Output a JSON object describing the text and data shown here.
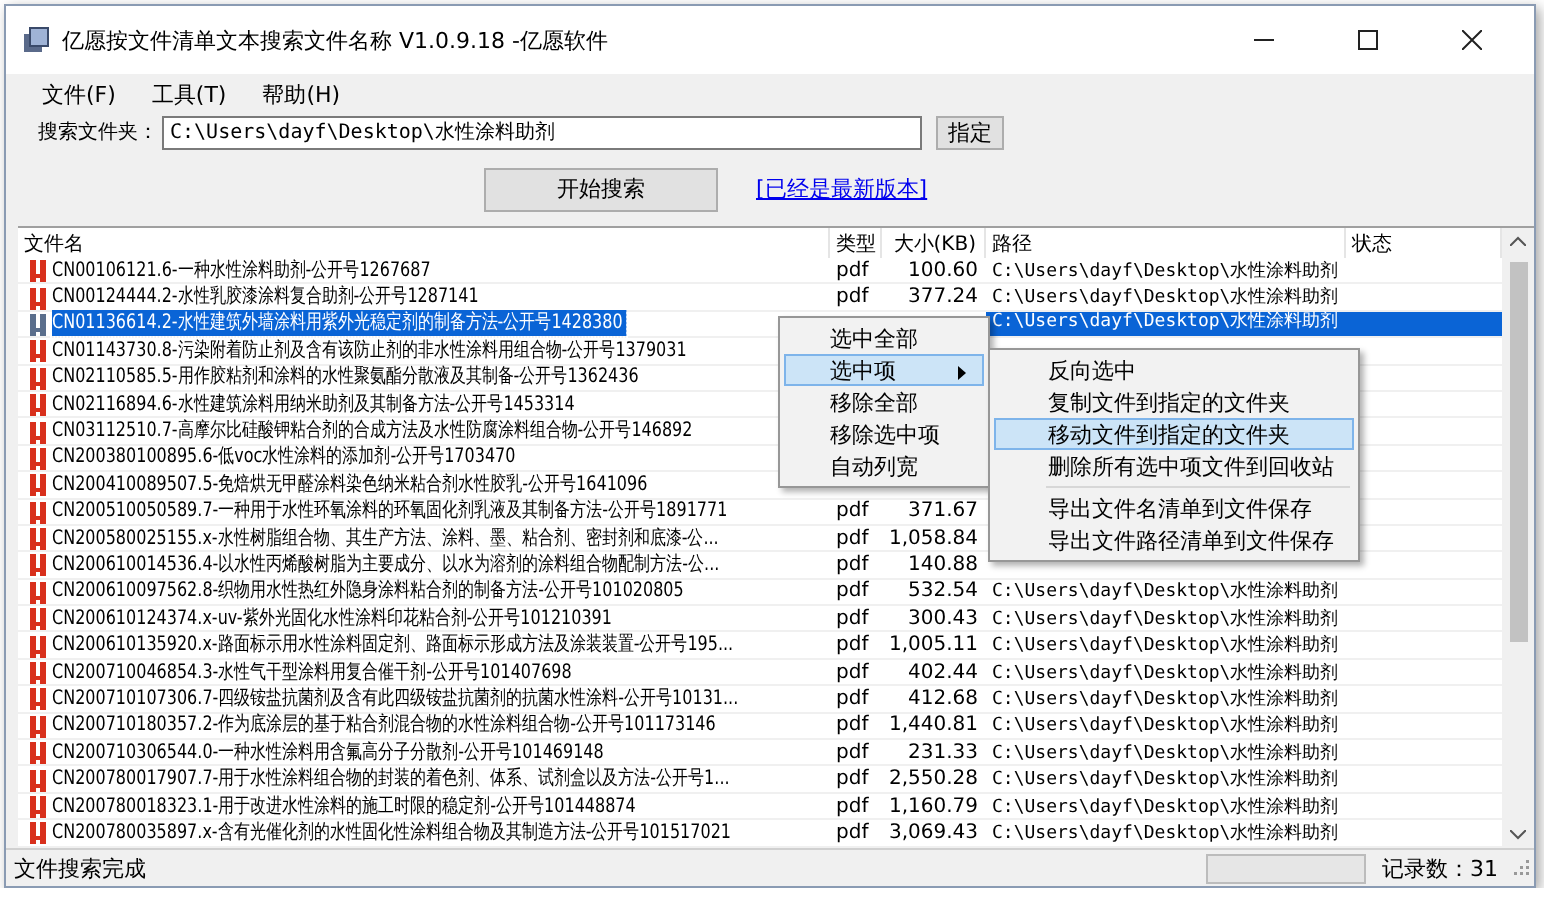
{
  "window": {
    "title": "亿愿按文件清单文本搜索文件名称 V1.0.9.18 -亿愿软件"
  },
  "menu": [
    "文件(F)",
    "工具(T)",
    "帮助(H)"
  ],
  "search": {
    "label": "搜索文件夹：",
    "value": "C:\\Users\\dayf\\Desktop\\水性涂料助剂",
    "browse_button": "指定",
    "start_button": "开始搜索",
    "update_link": "[已经是最新版本]"
  },
  "table": {
    "columns": [
      "文件名",
      "类型",
      "大小(KB)",
      "路径",
      "状态"
    ],
    "rows": [
      {
        "name": "CN00106121.6-一种水性涂料助剂-公开号1267687",
        "type": "pdf",
        "size": "100.60",
        "path": "C:\\Users\\dayf\\Desktop\\水性涂料助剂",
        "selected": false
      },
      {
        "name": "CN00124444.2-水性乳胶漆涂料复合助剂-公开号1287141",
        "type": "pdf",
        "size": "377.24",
        "path": "C:\\Users\\dayf\\Desktop\\水性涂料助剂",
        "selected": false
      },
      {
        "name": "CN01136614.2-水性建筑外墙涂料用紫外光稳定剂的制备方法-公开号1428380",
        "path": "C:\\Users\\dayf\\Desktop\\水性涂料助剂",
        "selected": true
      },
      {
        "name": "CN01143730.8-污染附着防止剂及含有该防止剂的非水性涂料用组合物-公开号1379031",
        "selected": false
      },
      {
        "name": "CN02110585.5-用作胶粘剂和涂料的水性聚氨酯分散液及其制备-公开号1362436",
        "selected": false
      },
      {
        "name": "CN02116894.6-水性建筑涂料用纳米助剂及其制备方法-公开号1453314",
        "selected": false
      },
      {
        "name": "CN03112510.7-高摩尔比硅酸钾粘合剂的合成方法及水性防腐涂料组合物-公开号146892",
        "selected": false
      },
      {
        "name": "CN200380100895.6-低voc水性涂料的添加剂-公开号1703470",
        "selected": false
      },
      {
        "name": "CN200410089507.5-免焙烘无甲醛涂料染色纳米粘合剂水性胶乳-公开号1641096",
        "selected": false
      },
      {
        "name": "CN200510050589.7-一种用于水性环氧涂料的环氧固化剂乳液及其制备方法-公开号1891771",
        "type": "pdf",
        "size": "371.67",
        "selected": false
      },
      {
        "name": "CN200580025155.x-水性树脂组合物、其生产方法、涂料、墨、粘合剂、密封剂和底漆-公...",
        "type": "pdf",
        "size": "1,058.84",
        "selected": false
      },
      {
        "name": "CN200610014536.4-以水性丙烯酸树脂为主要成分、以水为溶剂的涂料组合物配制方法-公...",
        "type": "pdf",
        "size": "140.88",
        "selected": false
      },
      {
        "name": "CN200610097562.8-织物用水性热红外隐身涂料粘合剂的制备方法-公开号101020805",
        "type": "pdf",
        "size": "532.54",
        "path": "C:\\Users\\dayf\\Desktop\\水性涂料助剂",
        "selected": false
      },
      {
        "name": "CN200610124374.x-uv-紫外光固化水性涂料印花粘合剂-公开号101210391",
        "type": "pdf",
        "size": "300.43",
        "path": "C:\\Users\\dayf\\Desktop\\水性涂料助剂",
        "selected": false
      },
      {
        "name": "CN200610135920.x-路面标示用水性涂料固定剂、路面标示形成方法及涂装装置-公开号195...",
        "type": "pdf",
        "size": "1,005.11",
        "path": "C:\\Users\\dayf\\Desktop\\水性涂料助剂",
        "selected": false
      },
      {
        "name": "CN200710046854.3-水性气干型涂料用复合催干剂-公开号101407698",
        "type": "pdf",
        "size": "402.44",
        "path": "C:\\Users\\dayf\\Desktop\\水性涂料助剂",
        "selected": false
      },
      {
        "name": "CN200710107306.7-四级铵盐抗菌剂及含有此四级铵盐抗菌剂的抗菌水性涂料-公开号10131...",
        "type": "pdf",
        "size": "412.68",
        "path": "C:\\Users\\dayf\\Desktop\\水性涂料助剂",
        "selected": false
      },
      {
        "name": "CN200710180357.2-作为底涂层的基于粘合剂混合物的水性涂料组合物-公开号101173146",
        "type": "pdf",
        "size": "1,440.81",
        "path": "C:\\Users\\dayf\\Desktop\\水性涂料助剂",
        "selected": false
      },
      {
        "name": "CN200710306544.0-一种水性涂料用含氟高分子分散剂-公开号101469148",
        "type": "pdf",
        "size": "231.33",
        "path": "C:\\Users\\dayf\\Desktop\\水性涂料助剂",
        "selected": false
      },
      {
        "name": "CN200780017907.7-用于水性涂料组合物的封装的着色剂、体系、试剂盒以及方法-公开号1...",
        "type": "pdf",
        "size": "2,550.28",
        "path": "C:\\Users\\dayf\\Desktop\\水性涂料助剂",
        "selected": false
      },
      {
        "name": "CN200780018323.1-用于改进水性涂料的施工时限的稳定剂-公开号101448874",
        "type": "pdf",
        "size": "1,160.79",
        "path": "C:\\Users\\dayf\\Desktop\\水性涂料助剂",
        "selected": false
      },
      {
        "name": "CN200780035897.x-含有光催化剂的水性固化性涂料组合物及其制造方法-公开号101517021",
        "type": "pdf",
        "size": "3,069.43",
        "path": "C:\\Users\\dayf\\Desktop\\水性涂料助剂",
        "selected": false
      }
    ]
  },
  "context_menu": {
    "items": [
      {
        "label": "选中全部",
        "selected": false
      },
      {
        "label": "选中项",
        "selected": true,
        "submenu": true
      },
      {
        "label": "移除全部",
        "selected": false
      },
      {
        "label": "移除选中项",
        "selected": false
      },
      {
        "label": "自动列宽",
        "selected": false
      }
    ]
  },
  "submenu": {
    "items": [
      {
        "kind": "item",
        "label": "反向选中",
        "selected": false
      },
      {
        "kind": "item",
        "label": "复制文件到指定的文件夹",
        "selected": false
      },
      {
        "kind": "item",
        "label": "移动文件到指定的文件夹",
        "selected": true
      },
      {
        "kind": "item",
        "label": "删除所有选中项文件到回收站",
        "selected": false
      },
      {
        "kind": "separator"
      },
      {
        "kind": "item",
        "label": "导出文件名清单到文件保存",
        "selected": false
      },
      {
        "kind": "item",
        "label": "导出文件路径清单到文件保存",
        "selected": false
      }
    ]
  },
  "status_bar": {
    "message": "文件搜索完成",
    "progress": {
      "level": 0
    },
    "count": "记录数：31"
  }
}
